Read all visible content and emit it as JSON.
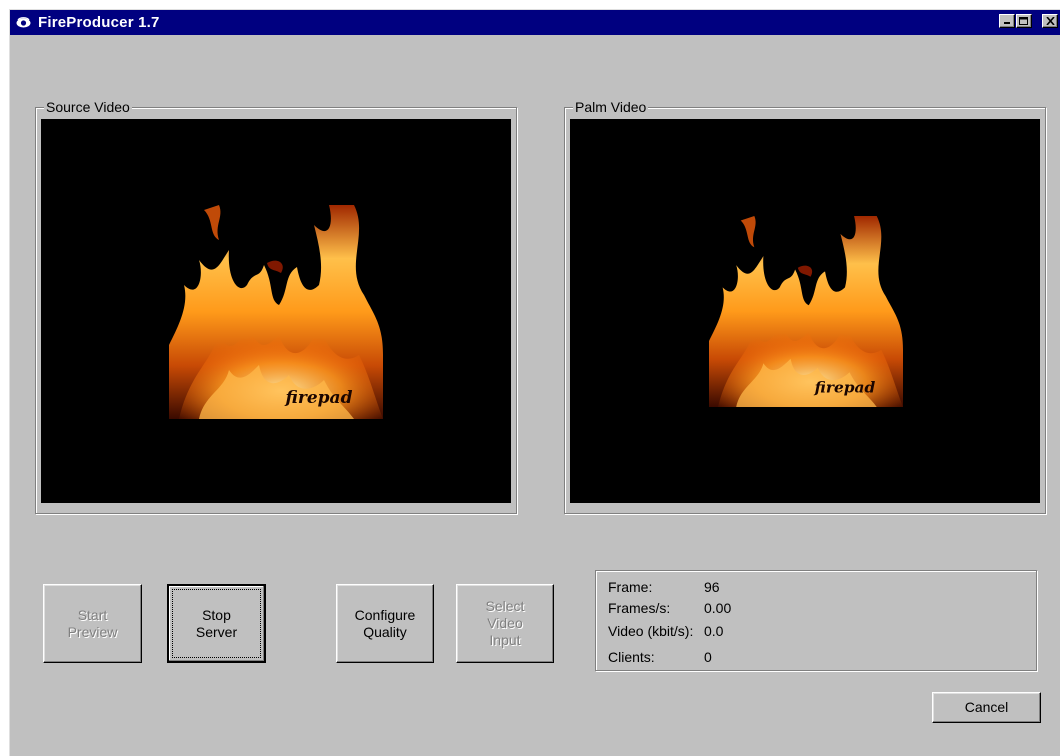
{
  "window": {
    "title": "FireProducer 1.7",
    "app_icon": "eye-icon",
    "controls": [
      "minimize-icon",
      "maximize-icon",
      "close-icon"
    ]
  },
  "source_video": {
    "label": "Source Video",
    "watermark": "firepad"
  },
  "palm_video": {
    "label": "Palm Video",
    "watermark": "firepad"
  },
  "buttons": {
    "start_preview": "Start\nPreview",
    "stop_server": "Stop\nServer",
    "configure_quality": "Configure\nQuality",
    "select_video_input": "Select\nVideo\nInput",
    "cancel": "Cancel"
  },
  "stats": {
    "frame_label": "Frame:",
    "frame_value": "96",
    "fps_label": "Frames/s:",
    "fps_value": "0.00",
    "video_label": "Video (kbit/s):",
    "video_value": "0.0",
    "clients_label": "Clients:",
    "clients_value": "0"
  },
  "colors": {
    "titlebar": "#000080",
    "face": "#c0c0c0",
    "video_bg": "#000000",
    "disabled_text": "#808080"
  }
}
